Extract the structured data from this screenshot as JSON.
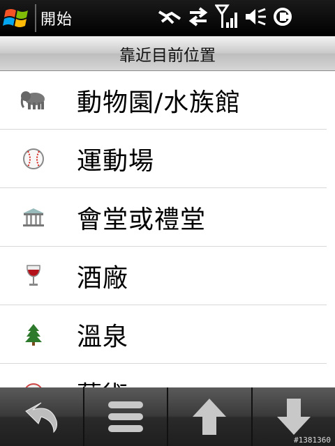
{
  "statusbar": {
    "start_label": "開始",
    "icons": [
      "windows-logo-icon",
      "connectivity-icon",
      "data-transfer-icon",
      "signal-strength-icon",
      "volume-muted-icon",
      "battery-charging-icon"
    ]
  },
  "header": {
    "title": "靠近目前位置"
  },
  "list": {
    "items": [
      {
        "label": "動物園/水族館",
        "icon": "elephant-icon"
      },
      {
        "label": "運動場",
        "icon": "baseball-icon"
      },
      {
        "label": "會堂或禮堂",
        "icon": "auditorium-icon"
      },
      {
        "label": "酒廠",
        "icon": "wine-glass-icon"
      },
      {
        "label": "溫泉",
        "icon": "tree-icon"
      },
      {
        "label": "藝術",
        "icon": "partial-icon"
      }
    ]
  },
  "toolbar": {
    "buttons": [
      "back-icon",
      "menu-icon",
      "up-arrow-icon",
      "down-arrow-icon"
    ]
  },
  "watermark": "#1381360",
  "colors": {
    "accent_red": "#d8251d",
    "list_bg": "#ffffff",
    "divider": "#d7d7d7"
  }
}
